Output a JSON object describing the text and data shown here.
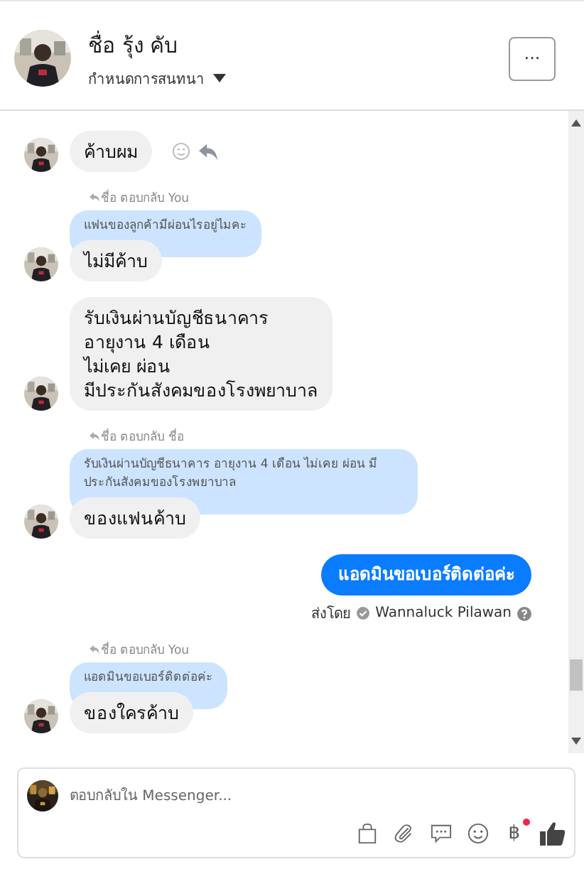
{
  "header": {
    "name": "ชื่อ รุ้ง คับ",
    "subtitle": "กำหนดการสนทนา",
    "more_button": "···"
  },
  "messages": [
    {
      "kind": "incoming",
      "text": "ค้าบผม",
      "actions": true
    },
    {
      "kind": "reply",
      "reply_label": "ชื่อ ตอบกลับ You",
      "quoted": "แฟนของลูกค้ามีผ่อนไรอยู่ไมคะ",
      "text": "ไม่มีค้าบ"
    },
    {
      "kind": "incoming",
      "text": "รับเงินผ่านบัญชีธนาคาร\nอายุงาน 4 เดือน\nไม่เคย ผ่อน\nมีประกันสังคมของโรงพยาบาล",
      "actions": false
    },
    {
      "kind": "reply",
      "reply_label": "ชื่อ ตอบกลับ ชื่อ",
      "quoted": "รับเงินผ่านบัญชีธนาคาร อายุงาน 4 เดือน ไม่เคย ผ่อน มีประกันสังคมของโรงพยาบาล",
      "text": "ของแฟนค้าบ"
    },
    {
      "kind": "outgoing",
      "text": "แอดมินขอเบอร์ติดต่อค่ะ",
      "sent_by": "ส่งโดย",
      "sender": "Wannaluck Pilawan"
    },
    {
      "kind": "reply",
      "reply_label": "ชื่อ ตอบกลับ You",
      "quoted": "แอดมินขอเบอร์ติดต่อค่ะ",
      "text": "ของใครค้าบ"
    }
  ],
  "composer": {
    "placeholder": "ตอบกลับใน Messenger...",
    "currency_symbol": "฿",
    "currency_notification": true
  }
}
